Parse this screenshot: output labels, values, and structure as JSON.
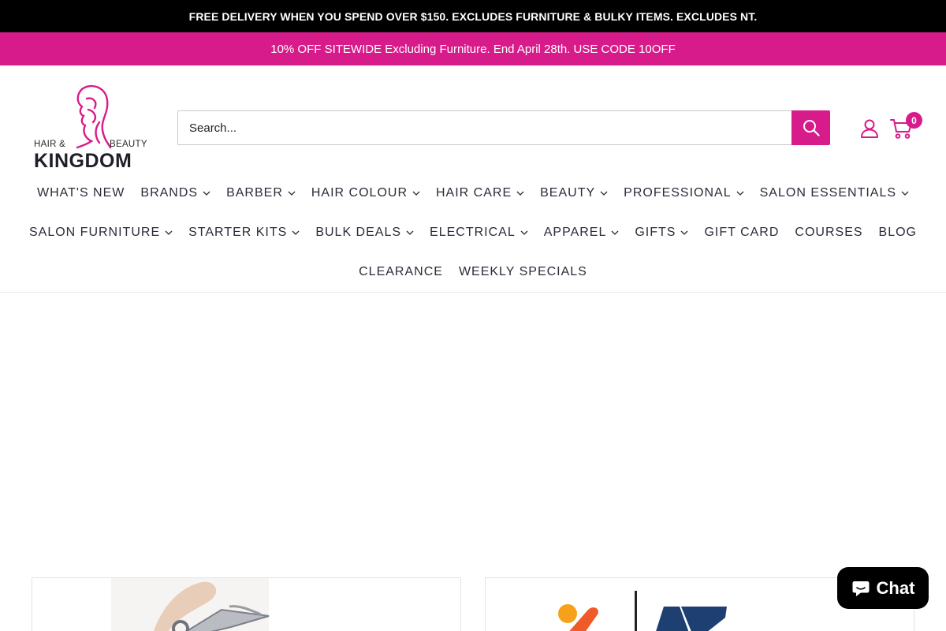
{
  "announcement": {
    "text": "FREE DELIVERY WHEN YOU SPEND OVER $150. EXCLUDES FURNITURE & BULKY ITEMS. EXCLUDES NT."
  },
  "promo": {
    "text": "10% OFF SITEWIDE Excluding Furniture. End April 28th. USE CODE 10OFF"
  },
  "logo": {
    "small_left": "HAIR &",
    "small_right": "BEAUTY",
    "main": "KINGDOM"
  },
  "search": {
    "placeholder": "Search..."
  },
  "cart": {
    "count": "0"
  },
  "nav": {
    "row1": [
      {
        "label": "WHAT'S NEW",
        "dropdown": false
      },
      {
        "label": "BRANDS",
        "dropdown": true
      },
      {
        "label": "BARBER",
        "dropdown": true
      },
      {
        "label": "HAIR COLOUR",
        "dropdown": true
      },
      {
        "label": "HAIR CARE",
        "dropdown": true
      },
      {
        "label": "BEAUTY",
        "dropdown": true
      },
      {
        "label": "PROFESSIONAL",
        "dropdown": true
      },
      {
        "label": "SALON ESSENTIALS",
        "dropdown": true
      }
    ],
    "row2": [
      {
        "label": "SALON FURNITURE",
        "dropdown": true
      },
      {
        "label": "STARTER KITS",
        "dropdown": true
      },
      {
        "label": "BULK DEALS",
        "dropdown": true
      },
      {
        "label": "ELECTRICAL",
        "dropdown": true
      },
      {
        "label": "APPAREL",
        "dropdown": true
      },
      {
        "label": "GIFTS",
        "dropdown": true
      },
      {
        "label": "GIFT CARD",
        "dropdown": false
      },
      {
        "label": "COURSES",
        "dropdown": false
      },
      {
        "label": "BLOG",
        "dropdown": false
      }
    ],
    "row3": [
      {
        "label": "CLEARANCE",
        "dropdown": false
      },
      {
        "label": "WEEKLY SPECIALS",
        "dropdown": false
      }
    ]
  },
  "chat": {
    "label": "Chat"
  },
  "colors": {
    "brand_pink": "#d81b8a",
    "announcement_bg": "#000000",
    "chat_bg": "#000000"
  },
  "icons": {
    "search": "search-icon",
    "account": "user-icon",
    "cart": "cart-icon",
    "chat": "chat-bubble-icon",
    "dropdown": "chevron-down-icon"
  }
}
